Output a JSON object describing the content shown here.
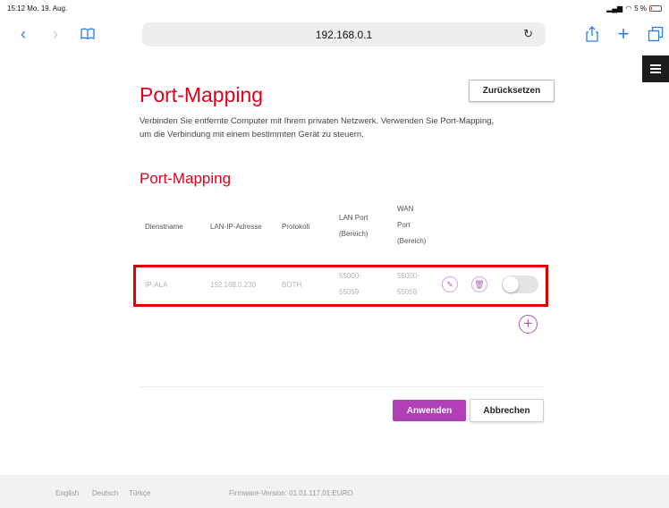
{
  "status_bar": {
    "time": "15:12",
    "date": "Mo. 19. Aug.",
    "battery": "5 %"
  },
  "browser": {
    "url": "192.168.0.1",
    "icons": {
      "back": "chevron-left-icon",
      "forward": "chevron-right-icon",
      "bookmarks": "book-icon",
      "reload": "reload-icon",
      "share": "share-icon",
      "new_tab": "plus-icon",
      "tabs": "tabs-icon"
    }
  },
  "page": {
    "title": "Port-Mapping",
    "reset_label": "Zurücksetzen",
    "description_line1": "Verbinden Sie entfernte Computer mit Ihrem privaten Netzwerk. Verwenden Sie Port-Mapping,",
    "description_line2": "um die Verbindung mit einem bestimmten Gerät zu steuern.",
    "section_title": "Port-Mapping",
    "table": {
      "headers": {
        "service": "Dienstname",
        "lan_ip": "LAN-IP-Adresse",
        "protocol": "Protokoll",
        "lan_port_1": "LAN Port",
        "lan_port_2": "(Bereich)",
        "wan_port_1": "WAN",
        "wan_port_2": "Port",
        "wan_port_3": "(Bereich)"
      },
      "rows": [
        {
          "service": "IP-ALA",
          "lan_ip": "192.168.0.230",
          "protocol": "BOTH",
          "lan_port_1": "55000-",
          "lan_port_2": "55059",
          "wan_port_1": "55000-",
          "wan_port_2": "55059",
          "enabled": false
        }
      ]
    },
    "apply_label": "Anwenden",
    "cancel_label": "Abbrechen"
  },
  "footer": {
    "languages": [
      "English",
      "Deutsch",
      "Türkçe"
    ],
    "firmware": "Firmware-Version: 01.01.117.01.EURO"
  },
  "colors": {
    "brand_red": "#e2001a",
    "accent_purple": "#b13fb8",
    "highlight": "#e00000"
  }
}
